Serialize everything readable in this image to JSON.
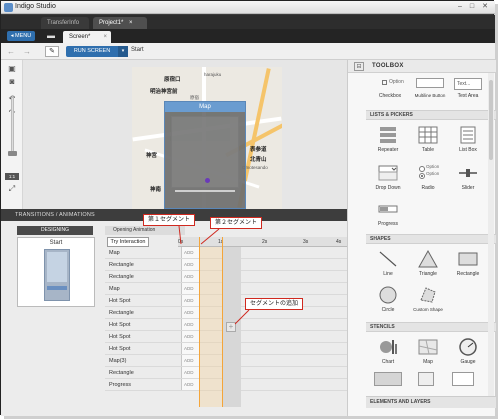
{
  "window": {
    "title": "Indigo Studio"
  },
  "doc_tabs": [
    {
      "label": "TransferInfo",
      "active": false
    },
    {
      "label": "Project1*",
      "active": true
    }
  ],
  "menu": {
    "label": "MENU",
    "screen_tab": "Screen*"
  },
  "toolbar": {
    "run_label": "RUN SCREEN",
    "start_select": "Start"
  },
  "canvas": {
    "map_dialog_title": "Map",
    "map_labels": [
      "原宿口",
      "明治神宮前",
      "神宮",
      "神南",
      "表参道",
      "北青山",
      "harajuku",
      "Omotesando",
      "原宿"
    ]
  },
  "toolbox": {
    "title": "TOOLBOX",
    "top_items": [
      {
        "label": "Checkbox",
        "icon": "checkbox-icon"
      },
      {
        "label": "Multiline Button",
        "icon": "multiline-button-icon"
      },
      {
        "label": "Text Area",
        "icon": "text-area-icon"
      }
    ],
    "option_label": "Option",
    "text_sample": "Text...",
    "sections": [
      {
        "title": "LISTS & PICKERS",
        "items": [
          {
            "label": "Repeater",
            "icon": "repeater-icon"
          },
          {
            "label": "Table",
            "icon": "table-icon"
          },
          {
            "label": "List Box",
            "icon": "list-box-icon"
          },
          {
            "label": "Drop Down",
            "icon": "drop-down-icon"
          },
          {
            "label": "Radio",
            "icon": "radio-icon"
          },
          {
            "label": "Slider",
            "icon": "slider-icon"
          },
          {
            "label": "Progress",
            "icon": "progress-icon"
          }
        ]
      },
      {
        "title": "SHAPES",
        "items": [
          {
            "label": "Line",
            "icon": "line-icon"
          },
          {
            "label": "Triangle",
            "icon": "triangle-icon"
          },
          {
            "label": "Rectangle",
            "icon": "rectangle-icon"
          },
          {
            "label": "Circle",
            "icon": "circle-icon"
          },
          {
            "label": "Custom Shape",
            "icon": "custom-shape-icon"
          }
        ]
      },
      {
        "title": "STENCILS",
        "items": [
          {
            "label": "Chart",
            "icon": "chart-icon"
          },
          {
            "label": "Map",
            "icon": "map-icon"
          },
          {
            "label": "Gauge",
            "icon": "gauge-icon"
          }
        ]
      }
    ],
    "elements_bar": "ELEMENTS AND LAYERS"
  },
  "transitions": {
    "header": "TRANSITIONS / ANIMATIONS",
    "designing": "DESIGNING",
    "opening": "Opening Animation",
    "start_state": "Start",
    "try_label": "Try Interaction",
    "ticks": [
      "0s",
      "1s",
      "2s",
      "3s",
      "4s"
    ],
    "duration_label": "ADD",
    "rows": [
      "Map",
      "Rectangle",
      "Rectangle",
      "Map",
      "Hot Spot",
      "Rectangle",
      "Hot Spot",
      "Hot Spot",
      "Hot Spot",
      "Map(3)",
      "Rectangle",
      "Progress"
    ]
  },
  "callouts": {
    "segment1": "第１セグメント",
    "segment2": "第２セグメント",
    "add_segment": "セグメントの追加"
  },
  "colors": {
    "accent": "#2f6fae",
    "segment": "#f4a53a",
    "callout_border": "#d0291f"
  }
}
